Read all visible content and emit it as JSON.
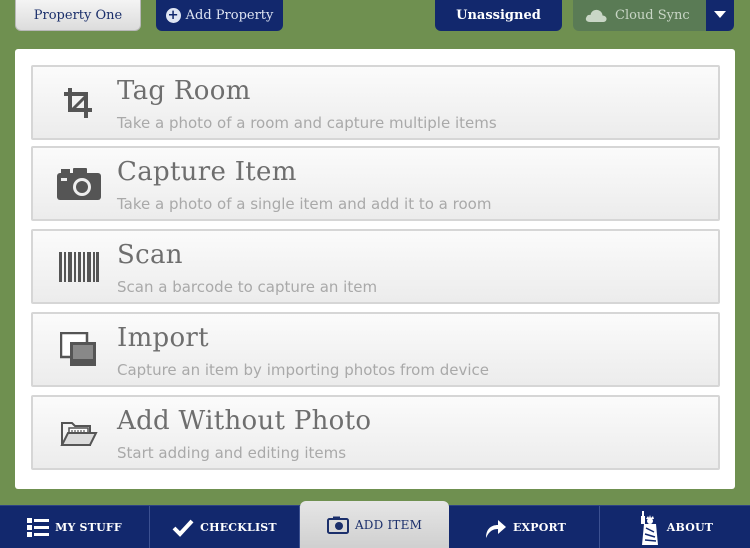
{
  "header": {
    "property_label": "Property One",
    "add_property_label": "Add Property",
    "unassigned_label": "Unassigned",
    "cloud_sync_label": "Cloud Sync"
  },
  "actions": [
    {
      "title": "Tag Room",
      "desc": "Take a photo of a room and capture multiple items",
      "icon": "crop-icon"
    },
    {
      "title": "Capture Item",
      "desc": "Take a photo of a single item and add it to a room",
      "icon": "camera-icon"
    },
    {
      "title": "Scan",
      "desc": "Scan a barcode to capture an item",
      "icon": "barcode-icon"
    },
    {
      "title": "Import",
      "desc": "Capture an item by importing photos from device",
      "icon": "photos-icon"
    },
    {
      "title": "Add Without Photo",
      "desc": "Start adding and editing items",
      "icon": "folder-icon"
    }
  ],
  "tabs": [
    {
      "label": "MY STUFF",
      "icon": "list-icon"
    },
    {
      "label": "CHECKLIST",
      "icon": "checkmark-icon"
    },
    {
      "label": "ADD ITEM",
      "icon": "camera-icon",
      "active": true
    },
    {
      "label": "EXPORT",
      "icon": "share-arrow-icon"
    },
    {
      "label": "ABOUT",
      "icon": "statue-of-liberty-icon"
    }
  ],
  "colors": {
    "background": "#6f9050",
    "navy": "#12286d",
    "cloud_button": "#5a7b55"
  }
}
